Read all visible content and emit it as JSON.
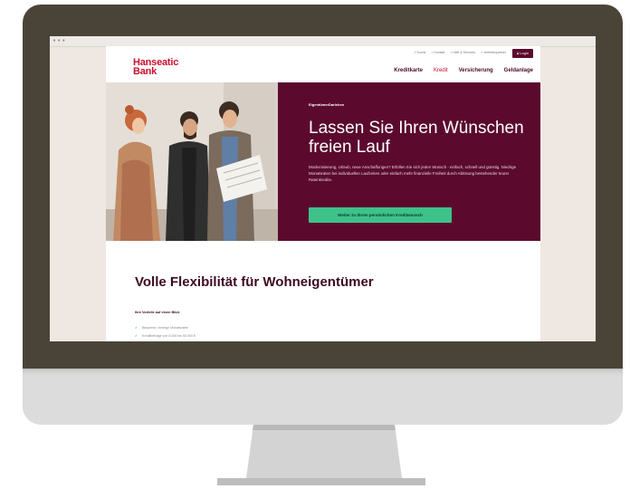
{
  "window": {
    "dots": "•••"
  },
  "header": {
    "logo_line1": "Hanseatic",
    "logo_line2": "Bank",
    "utility_links": [
      "// Suche",
      "> Kontakt",
      "> Hilfe & Services",
      "> Vertriebspartner"
    ],
    "login_label": "Login",
    "nav_items": [
      "Kreditkarte",
      "Kredit",
      "Versicherung",
      "Geldanlage"
    ]
  },
  "hero": {
    "eyebrow": "EigentümerDarlehen",
    "title": "Lassen Sie Ihren Wünschen freien Lauf",
    "text": "Modernisierung, Urlaub, neue Anschaffungen? Erfüllen Sie sich jeden Wunsch - einfach, schnell und günstig. Niedrige Monatsraten bei individuellen Laufzeiten oder einfach mehr finanzielle Freiheit durch Ablösung bestehender teurer Ratenkredite.",
    "cta_label": "Weiter zu Ihrem persönlichen Kreditwunsch"
  },
  "section": {
    "title": "Volle Flexibilität für Wohneigentümer",
    "benefits_heading": "Ihre Vorteile auf einen Blick",
    "benefits": [
      "Bequeme, niedrige Monatsraten",
      "Kreditbeträge von 5.000 bis 60.000 €"
    ]
  },
  "colors": {
    "brand_red": "#c8102e",
    "hero_burgundy": "#5b0a2e",
    "cta_green": "#3ec28a",
    "monitor_frame": "#4a4438"
  }
}
